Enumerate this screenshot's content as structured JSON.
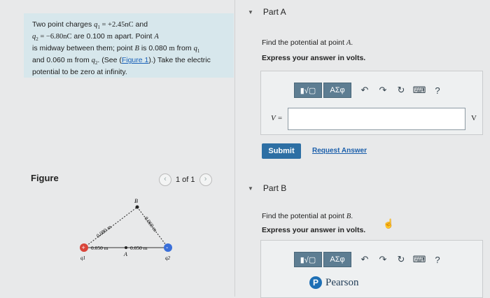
{
  "problem": {
    "t1": "Two point charges ",
    "q1_sym": "q",
    "q1_sub": "1",
    "q1_val": " = +2.45",
    "unit_nC1": "nC",
    "t2": " and",
    "q2_sym": "q",
    "q2_sub": "2",
    "q2_val": " = −6.80",
    "unit_nC2": "nC",
    "t3": " are 0.100 ",
    "m1": "m",
    "t4": " apart. Point ",
    "A": "A",
    "t5": " is midway between them; point ",
    "B": "B",
    "t6": " is 0.080 ",
    "m2": "m",
    "t7": " from ",
    "q1b": "q",
    "q1b_sub": "1",
    "t8": " and 0.060 ",
    "m3": "m",
    "t9": " from ",
    "q2b": "q",
    "q2b_sub": "2",
    "t10": ". (See (",
    "fig_link": "Figure 1",
    "t11": ").) Take the electric potential to be zero at infinity."
  },
  "figure": {
    "label": "Figure",
    "pager": "1 of 1",
    "prev_icon": "chevron-left-icon",
    "next_icon": "chevron-right-icon",
    "point_B": "B",
    "point_A": "A",
    "q1_label": "q1",
    "q2_label": "q2",
    "dist_qB1": "0.080 m",
    "dist_qB2": "0.060 m",
    "dist_left": "0.050 m",
    "dist_right": "0.050 m",
    "q1_color": "#d9453a",
    "q2_color": "#3a6fd9"
  },
  "partA": {
    "title": "Part A",
    "question": "Find the potential at point ",
    "point": "A",
    "question_end": ".",
    "instruction": "Express your answer in volts.",
    "toolbar": {
      "greek": "ΑΣφ",
      "help": "?"
    },
    "var_label": "V =",
    "input_value": "",
    "unit": "V",
    "submit": "Submit",
    "request": "Request Answer"
  },
  "partB": {
    "title": "Part B",
    "question": "Find the potential at point ",
    "point": "B",
    "question_end": ".",
    "instruction": "Express your answer in volts.",
    "toolbar": {
      "greek": "ΑΣφ",
      "help": "?"
    }
  },
  "brand": {
    "name": "Pearson",
    "logo": "P"
  }
}
